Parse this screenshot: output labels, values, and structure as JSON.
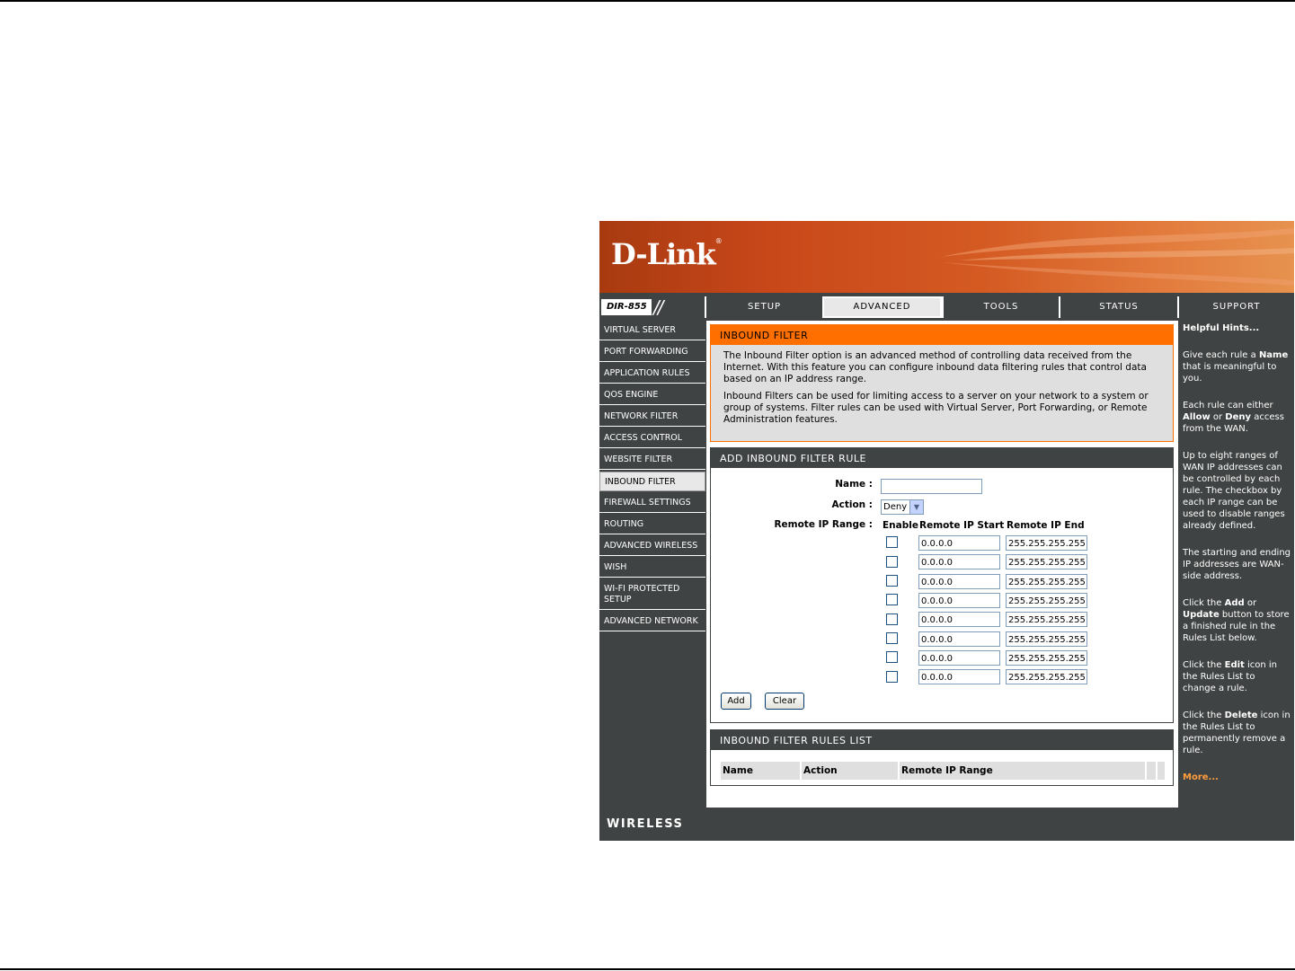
{
  "brand": {
    "logo": "D-Link",
    "model": "DIR-855",
    "model_slash": "//",
    "footer": "WIRELESS"
  },
  "tabs": [
    {
      "label": "SETUP"
    },
    {
      "label": "ADVANCED"
    },
    {
      "label": "TOOLS"
    },
    {
      "label": "STATUS"
    },
    {
      "label": "SUPPORT"
    }
  ],
  "sidebar": {
    "items": [
      {
        "label": "VIRTUAL SERVER"
      },
      {
        "label": "PORT FORWARDING"
      },
      {
        "label": "APPLICATION RULES"
      },
      {
        "label": "QOS ENGINE"
      },
      {
        "label": "NETWORK FILTER"
      },
      {
        "label": "ACCESS CONTROL"
      },
      {
        "label": "WEBSITE FILTER"
      },
      {
        "label": "INBOUND FILTER"
      },
      {
        "label": "FIREWALL SETTINGS"
      },
      {
        "label": "ROUTING"
      },
      {
        "label": "ADVANCED WIRELESS"
      },
      {
        "label": "WISH"
      },
      {
        "label": "WI-FI PROTECTED SETUP"
      },
      {
        "label": "ADVANCED NETWORK"
      }
    ]
  },
  "intro": {
    "title": "INBOUND FILTER",
    "p1": "The Inbound Filter option is an advanced method of controlling data received from the Internet. With this feature you can configure inbound data filtering rules that control data based on an IP address range.",
    "p2": "Inbound Filters can be used for limiting access to a server on your network to a system or group of systems. Filter rules can be used with Virtual Server, Port Forwarding, or Remote Administration features."
  },
  "add_rule": {
    "title": "ADD INBOUND FILTER RULE",
    "name_label": "Name :",
    "name_value": "",
    "action_label": "Action :",
    "action_value": "Deny",
    "range_label": "Remote IP Range :",
    "col_enable": "Enable",
    "col_start": "Remote IP Start",
    "col_end": "Remote IP End",
    "ranges": [
      {
        "start": "0.0.0.0",
        "end": "255.255.255.255"
      },
      {
        "start": "0.0.0.0",
        "end": "255.255.255.255"
      },
      {
        "start": "0.0.0.0",
        "end": "255.255.255.255"
      },
      {
        "start": "0.0.0.0",
        "end": "255.255.255.255"
      },
      {
        "start": "0.0.0.0",
        "end": "255.255.255.255"
      },
      {
        "start": "0.0.0.0",
        "end": "255.255.255.255"
      },
      {
        "start": "0.0.0.0",
        "end": "255.255.255.255"
      },
      {
        "start": "0.0.0.0",
        "end": "255.255.255.255"
      }
    ],
    "add_label": "Add",
    "clear_label": "Clear"
  },
  "rules_list": {
    "title": "INBOUND FILTER RULES LIST",
    "col_name": "Name",
    "col_action": "Action",
    "col_range": "Remote IP Range"
  },
  "hints": {
    "title": "Helpful Hints...",
    "h1_a": "Give each rule a ",
    "h1_b": "Name",
    "h1_c": " that is meaningful to you.",
    "h2_a": "Each rule can either ",
    "h2_b": "Allow",
    "h2_c": " or ",
    "h2_d": "Deny",
    "h2_e": " access from the WAN.",
    "h3": "Up to eight ranges of WAN IP addresses can be controlled by each rule. The checkbox by each IP range can be used to disable ranges already defined.",
    "h4": "The starting and ending IP addresses are WAN-side address.",
    "h5_a": "Click the ",
    "h5_b": "Add",
    "h5_c": " or ",
    "h5_d": "Update",
    "h5_e": " button to store a finished rule in the Rules List below.",
    "h6_a": "Click the ",
    "h6_b": "Edit",
    "h6_c": " icon in the Rules List to change a rule.",
    "h7_a": "Click the ",
    "h7_b": "Delete",
    "h7_c": " icon in the Rules List to permanently remove a rule.",
    "more": "More..."
  }
}
